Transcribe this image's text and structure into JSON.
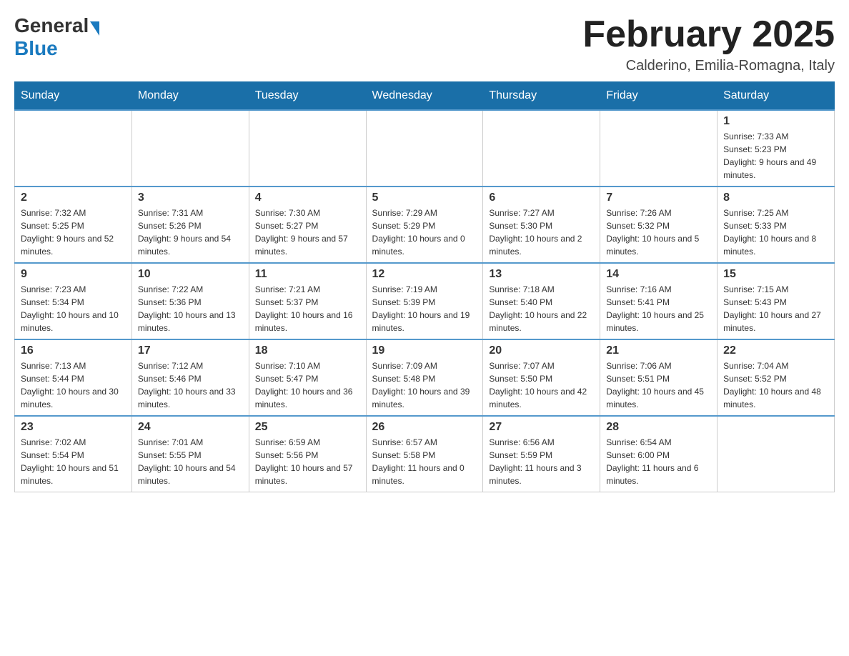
{
  "header": {
    "logo_general": "General",
    "logo_blue": "Blue",
    "month_title": "February 2025",
    "location": "Calderino, Emilia-Romagna, Italy"
  },
  "days_of_week": [
    "Sunday",
    "Monday",
    "Tuesday",
    "Wednesday",
    "Thursday",
    "Friday",
    "Saturday"
  ],
  "weeks": [
    [
      {
        "day": "",
        "info": ""
      },
      {
        "day": "",
        "info": ""
      },
      {
        "day": "",
        "info": ""
      },
      {
        "day": "",
        "info": ""
      },
      {
        "day": "",
        "info": ""
      },
      {
        "day": "",
        "info": ""
      },
      {
        "day": "1",
        "info": "Sunrise: 7:33 AM\nSunset: 5:23 PM\nDaylight: 9 hours and 49 minutes."
      }
    ],
    [
      {
        "day": "2",
        "info": "Sunrise: 7:32 AM\nSunset: 5:25 PM\nDaylight: 9 hours and 52 minutes."
      },
      {
        "day": "3",
        "info": "Sunrise: 7:31 AM\nSunset: 5:26 PM\nDaylight: 9 hours and 54 minutes."
      },
      {
        "day": "4",
        "info": "Sunrise: 7:30 AM\nSunset: 5:27 PM\nDaylight: 9 hours and 57 minutes."
      },
      {
        "day": "5",
        "info": "Sunrise: 7:29 AM\nSunset: 5:29 PM\nDaylight: 10 hours and 0 minutes."
      },
      {
        "day": "6",
        "info": "Sunrise: 7:27 AM\nSunset: 5:30 PM\nDaylight: 10 hours and 2 minutes."
      },
      {
        "day": "7",
        "info": "Sunrise: 7:26 AM\nSunset: 5:32 PM\nDaylight: 10 hours and 5 minutes."
      },
      {
        "day": "8",
        "info": "Sunrise: 7:25 AM\nSunset: 5:33 PM\nDaylight: 10 hours and 8 minutes."
      }
    ],
    [
      {
        "day": "9",
        "info": "Sunrise: 7:23 AM\nSunset: 5:34 PM\nDaylight: 10 hours and 10 minutes."
      },
      {
        "day": "10",
        "info": "Sunrise: 7:22 AM\nSunset: 5:36 PM\nDaylight: 10 hours and 13 minutes."
      },
      {
        "day": "11",
        "info": "Sunrise: 7:21 AM\nSunset: 5:37 PM\nDaylight: 10 hours and 16 minutes."
      },
      {
        "day": "12",
        "info": "Sunrise: 7:19 AM\nSunset: 5:39 PM\nDaylight: 10 hours and 19 minutes."
      },
      {
        "day": "13",
        "info": "Sunrise: 7:18 AM\nSunset: 5:40 PM\nDaylight: 10 hours and 22 minutes."
      },
      {
        "day": "14",
        "info": "Sunrise: 7:16 AM\nSunset: 5:41 PM\nDaylight: 10 hours and 25 minutes."
      },
      {
        "day": "15",
        "info": "Sunrise: 7:15 AM\nSunset: 5:43 PM\nDaylight: 10 hours and 27 minutes."
      }
    ],
    [
      {
        "day": "16",
        "info": "Sunrise: 7:13 AM\nSunset: 5:44 PM\nDaylight: 10 hours and 30 minutes."
      },
      {
        "day": "17",
        "info": "Sunrise: 7:12 AM\nSunset: 5:46 PM\nDaylight: 10 hours and 33 minutes."
      },
      {
        "day": "18",
        "info": "Sunrise: 7:10 AM\nSunset: 5:47 PM\nDaylight: 10 hours and 36 minutes."
      },
      {
        "day": "19",
        "info": "Sunrise: 7:09 AM\nSunset: 5:48 PM\nDaylight: 10 hours and 39 minutes."
      },
      {
        "day": "20",
        "info": "Sunrise: 7:07 AM\nSunset: 5:50 PM\nDaylight: 10 hours and 42 minutes."
      },
      {
        "day": "21",
        "info": "Sunrise: 7:06 AM\nSunset: 5:51 PM\nDaylight: 10 hours and 45 minutes."
      },
      {
        "day": "22",
        "info": "Sunrise: 7:04 AM\nSunset: 5:52 PM\nDaylight: 10 hours and 48 minutes."
      }
    ],
    [
      {
        "day": "23",
        "info": "Sunrise: 7:02 AM\nSunset: 5:54 PM\nDaylight: 10 hours and 51 minutes."
      },
      {
        "day": "24",
        "info": "Sunrise: 7:01 AM\nSunset: 5:55 PM\nDaylight: 10 hours and 54 minutes."
      },
      {
        "day": "25",
        "info": "Sunrise: 6:59 AM\nSunset: 5:56 PM\nDaylight: 10 hours and 57 minutes."
      },
      {
        "day": "26",
        "info": "Sunrise: 6:57 AM\nSunset: 5:58 PM\nDaylight: 11 hours and 0 minutes."
      },
      {
        "day": "27",
        "info": "Sunrise: 6:56 AM\nSunset: 5:59 PM\nDaylight: 11 hours and 3 minutes."
      },
      {
        "day": "28",
        "info": "Sunrise: 6:54 AM\nSunset: 6:00 PM\nDaylight: 11 hours and 6 minutes."
      },
      {
        "day": "",
        "info": ""
      }
    ]
  ]
}
